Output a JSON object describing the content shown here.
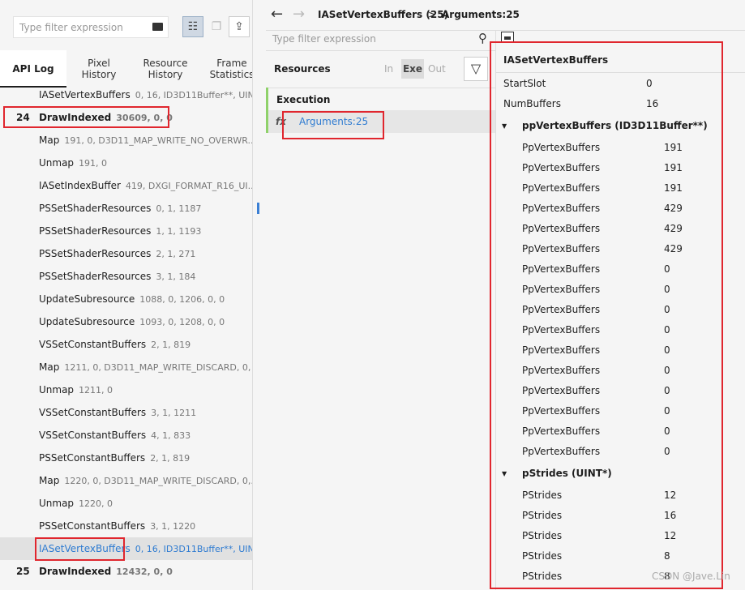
{
  "left_toolbar": {
    "filter_placeholder": "Type filter expression"
  },
  "tabs": [
    {
      "label": "API Log"
    },
    {
      "label": "Pixel History"
    },
    {
      "label": "Resource History"
    },
    {
      "label": "Frame Statistics"
    }
  ],
  "api_log": [
    {
      "num": "",
      "name": "IASetVertexBuffers",
      "args": "0, 16, ID3D11Buffer**, UINT...",
      "bold": false
    },
    {
      "num": "24",
      "name": "DrawIndexed",
      "args": "30609, 0, 0",
      "bold": true
    },
    {
      "num": "",
      "name": "Map",
      "args": "191, 0, D3D11_MAP_WRITE_NO_OVERWR...",
      "bold": false
    },
    {
      "num": "",
      "name": "Unmap",
      "args": "191, 0",
      "bold": false
    },
    {
      "num": "",
      "name": "IASetIndexBuffer",
      "args": "419, DXGI_FORMAT_R16_UI...",
      "bold": false
    },
    {
      "num": "",
      "name": "PSSetShaderResources",
      "args": "0, 1, 1187",
      "bold": false
    },
    {
      "num": "",
      "name": "PSSetShaderResources",
      "args": "1, 1, 1193",
      "bold": false
    },
    {
      "num": "",
      "name": "PSSetShaderResources",
      "args": "2, 1, 271",
      "bold": false
    },
    {
      "num": "",
      "name": "PSSetShaderResources",
      "args": "3, 1, 184",
      "bold": false
    },
    {
      "num": "",
      "name": "UpdateSubresource",
      "args": "1088, 0, 1206, 0, 0",
      "bold": false
    },
    {
      "num": "",
      "name": "UpdateSubresource",
      "args": "1093, 0, 1208, 0, 0",
      "bold": false
    },
    {
      "num": "",
      "name": "VSSetConstantBuffers",
      "args": "2, 1, 819",
      "bold": false
    },
    {
      "num": "",
      "name": "Map",
      "args": "1211, 0, D3D11_MAP_WRITE_DISCARD, 0, ...",
      "bold": false
    },
    {
      "num": "",
      "name": "Unmap",
      "args": "1211, 0",
      "bold": false
    },
    {
      "num": "",
      "name": "VSSetConstantBuffers",
      "args": "3, 1, 1211",
      "bold": false
    },
    {
      "num": "",
      "name": "VSSetConstantBuffers",
      "args": "4, 1, 833",
      "bold": false
    },
    {
      "num": "",
      "name": "PSSetConstantBuffers",
      "args": "2, 1, 819",
      "bold": false
    },
    {
      "num": "",
      "name": "Map",
      "args": "1220, 0, D3D11_MAP_WRITE_DISCARD, 0,...",
      "bold": false
    },
    {
      "num": "",
      "name": "Unmap",
      "args": "1220, 0",
      "bold": false
    },
    {
      "num": "",
      "name": "PSSetConstantBuffers",
      "args": "3, 1, 1220",
      "bold": false
    },
    {
      "num": "",
      "name": "IASetVertexBuffers",
      "args": "0, 16, ID3D11Buffer**, UINT...",
      "bold": false,
      "selected": true
    },
    {
      "num": "25",
      "name": "DrawIndexed",
      "args": "12432, 0, 0",
      "bold": true
    }
  ],
  "nav": {
    "breadcrumb_call": "IASetVertexBuffers (25)",
    "breadcrumb_sep": ">",
    "breadcrumb_current": "Arguments:25"
  },
  "mid": {
    "filter_placeholder": "Type filter expression",
    "resources_label": "Resources",
    "in_label": "In",
    "exe_label": "Exe",
    "out_label": "Out",
    "execution_label": "Execution",
    "fx_label": "fx",
    "arguments_item": "Arguments:25"
  },
  "details": {
    "title": "IASetVertexBuffers",
    "params": [
      {
        "name": "StartSlot",
        "value": "0"
      },
      {
        "name": "NumBuffers",
        "value": "16"
      }
    ],
    "groups": [
      {
        "label": "ppVertexBuffers (ID3D11Buffer**)",
        "items": [
          {
            "name": "PpVertexBuffers",
            "value": "191"
          },
          {
            "name": "PpVertexBuffers",
            "value": "191"
          },
          {
            "name": "PpVertexBuffers",
            "value": "191"
          },
          {
            "name": "PpVertexBuffers",
            "value": "429"
          },
          {
            "name": "PpVertexBuffers",
            "value": "429"
          },
          {
            "name": "PpVertexBuffers",
            "value": "429"
          },
          {
            "name": "PpVertexBuffers",
            "value": "0"
          },
          {
            "name": "PpVertexBuffers",
            "value": "0"
          },
          {
            "name": "PpVertexBuffers",
            "value": "0"
          },
          {
            "name": "PpVertexBuffers",
            "value": "0"
          },
          {
            "name": "PpVertexBuffers",
            "value": "0"
          },
          {
            "name": "PpVertexBuffers",
            "value": "0"
          },
          {
            "name": "PpVertexBuffers",
            "value": "0"
          },
          {
            "name": "PpVertexBuffers",
            "value": "0"
          },
          {
            "name": "PpVertexBuffers",
            "value": "0"
          },
          {
            "name": "PpVertexBuffers",
            "value": "0"
          }
        ]
      },
      {
        "label": "pStrides (UINT*)",
        "items": [
          {
            "name": "PStrides",
            "value": "12"
          },
          {
            "name": "PStrides",
            "value": "16"
          },
          {
            "name": "PStrides",
            "value": "12"
          },
          {
            "name": "PStrides",
            "value": "8"
          },
          {
            "name": "PStrides",
            "value": "8"
          }
        ]
      }
    ]
  },
  "watermark": "CSDN @Jave.Lin",
  "colors": {
    "annotation_red": "#e0262e",
    "link_blue": "#2e7bd1",
    "accent_green": "#8fd16a"
  }
}
